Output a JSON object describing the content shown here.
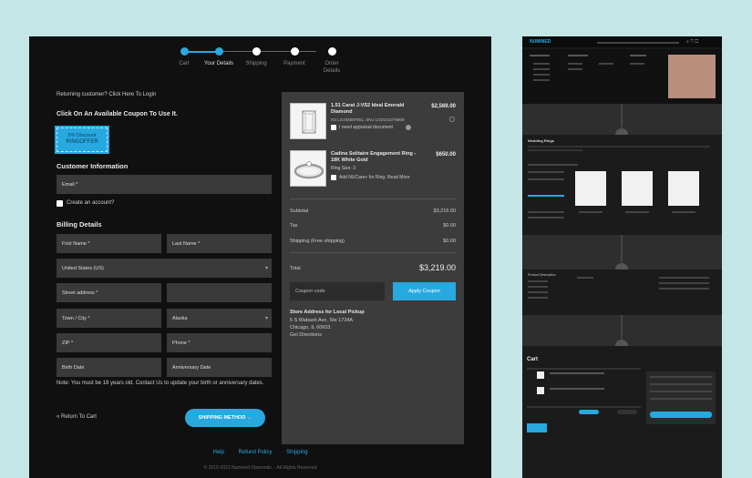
{
  "steps": [
    {
      "label": "Cart",
      "state": "done"
    },
    {
      "label": "Your Details",
      "state": "current"
    },
    {
      "label": "Shipping",
      "state": "todo"
    },
    {
      "label": "Payment",
      "state": "todo"
    },
    {
      "label": "Order Details",
      "state": "todo"
    }
  ],
  "returning": "Returning customer? Click Here To Login",
  "coupon_heading": "Click On An Available Coupon To Use It.",
  "coupon": {
    "line1": "5% Discount",
    "code": "RINGOFFER"
  },
  "customer_info": {
    "heading": "Customer Information",
    "email_placeholder": "Email *",
    "create_account": "Create an account?"
  },
  "billing": {
    "heading": "Billing Details",
    "first_name": "First Name *",
    "last_name": "Last Name *",
    "country": "United States (US)",
    "street": "Street address *",
    "street2": "",
    "town": "Town / City *",
    "state": "Alaska",
    "zip": "ZIP *",
    "phone": "Phone *",
    "birth": "Birth Date",
    "anniversary": "Anniversary Date",
    "note": "Note: You must be 18 years old. Contact Us to update your birth or anniversary dates."
  },
  "return_to_cart": "« Return To Cart",
  "shipping_button": "SHIPPING METHOD →",
  "summary": {
    "items": [
      {
        "title": "1.51 Carat J-VS2 Ideal Emerald Diamond",
        "sku": "IGI LG446087901, SKU LGD101079809",
        "option": "I need appraisal document",
        "price": "$2,569.00"
      },
      {
        "title": "Cadina Solitaire Engagement Ring - 18K White Gold",
        "sku": "Ring Size: 3",
        "option": "Add NUCare+ for Ring. Read More",
        "price": "$650.00"
      }
    ],
    "subtotal_label": "Subtotal",
    "subtotal": "$3,219.00",
    "tax_label": "Tax",
    "tax": "$0.00",
    "shipping_label": "Shipping (Free shipping)",
    "shipping": "$0.00",
    "total_label": "Total",
    "total": "$3,219.00",
    "coupon_placeholder": "Coupon code",
    "apply_coupon": "Apply Coupon",
    "pickup_heading": "Store Address for Local Pickup",
    "pickup_lines": [
      "5 S Wabash Ave, Ste 1734A",
      "Chicago, IL 60603",
      "Get Directions"
    ]
  },
  "footer": {
    "links": [
      "Help",
      "Refund Policy",
      "Shipping"
    ],
    "copyright": "© 2010-2021 Numined Diamonds. - All Rights Reserved"
  },
  "preview": {
    "logo": "NUMINED",
    "section1": "Wedding Rings",
    "section2": "Product Description",
    "cart_title": "Cart"
  },
  "colors": {
    "accent": "#27a9df",
    "panel": "#101010",
    "background": "#c5e6e6"
  }
}
